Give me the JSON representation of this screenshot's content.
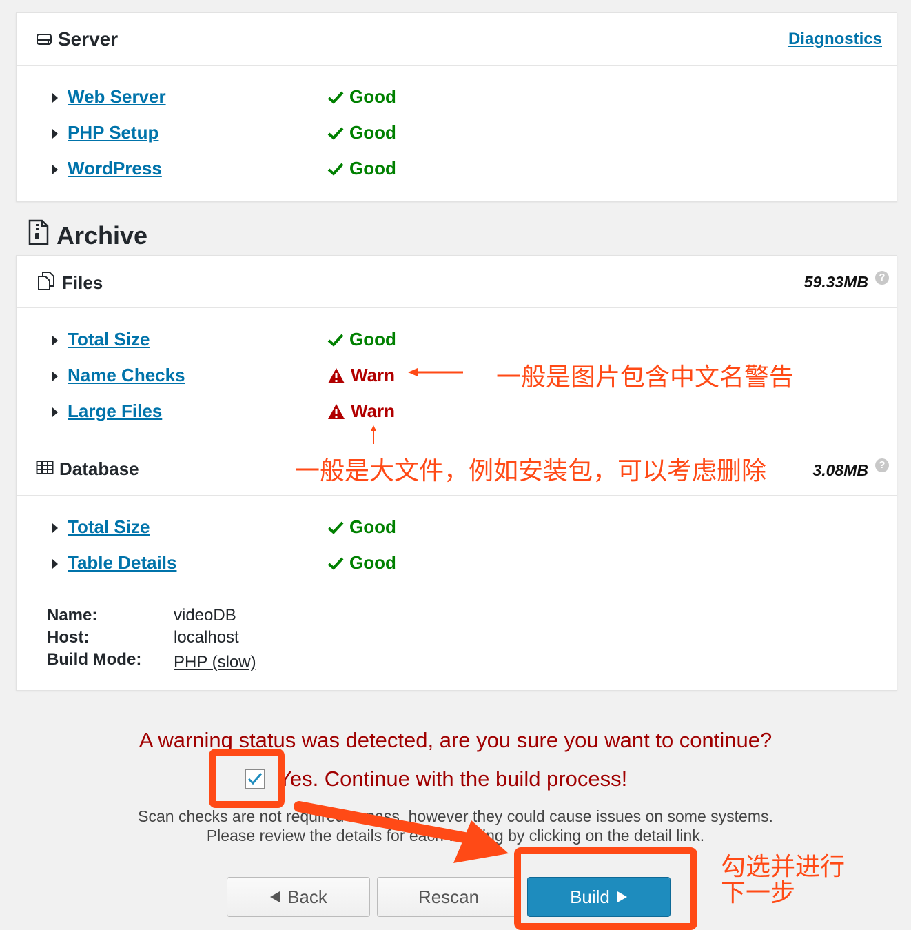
{
  "server": {
    "title": "Server",
    "diagnostics_link": "Diagnostics",
    "checks": [
      {
        "name": "Web Server",
        "status": "Good"
      },
      {
        "name": "PHP Setup",
        "status": "Good"
      },
      {
        "name": "WordPress",
        "status": "Good"
      }
    ]
  },
  "archive": {
    "title": "Archive",
    "files": {
      "title": "Files",
      "size": "59.33MB",
      "checks": [
        {
          "name": "Total Size",
          "status": "Good"
        },
        {
          "name": "Name Checks",
          "status": "Warn"
        },
        {
          "name": "Large Files",
          "status": "Warn"
        }
      ]
    },
    "database": {
      "title": "Database",
      "size": "3.08MB",
      "checks": [
        {
          "name": "Total Size",
          "status": "Good"
        },
        {
          "name": "Table Details",
          "status": "Good"
        }
      ],
      "info": {
        "name_label": "Name:",
        "name_value": "videoDB",
        "host_label": "Host:",
        "host_value": "localhost",
        "mode_label": "Build Mode:",
        "mode_value": "PHP (slow)"
      }
    }
  },
  "help_glyph": "?",
  "confirmation": {
    "warning": "A warning status was detected, are you sure you want to continue?",
    "checkbox_label": "Yes. Continue with the build process!",
    "checked": true,
    "note_line1": "Scan checks are not required to pass, however they could cause issues on some systems.",
    "note_line2": "Please review the details for each warning by clicking on the detail link."
  },
  "buttons": {
    "back": "Back",
    "rescan": "Rescan",
    "build": "Build"
  },
  "annotations": {
    "name_checks_note": "一般是图片包含中文名警告",
    "large_files_note": "一般是大文件，例如安装包，可以考虑删除",
    "build_note_line1": "勾选并进行",
    "build_note_line2": "下一步"
  },
  "colors": {
    "good": "#008000",
    "warn": "#b10000",
    "link": "#0073aa",
    "annotation": "#ff4a16",
    "primary_button": "#1e8cbe"
  }
}
